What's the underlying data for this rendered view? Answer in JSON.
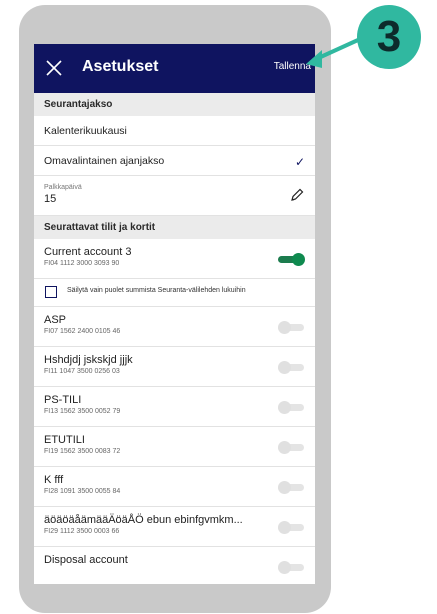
{
  "header": {
    "title": "Asetukset",
    "save_label": "Tallenna"
  },
  "tracking_period": {
    "section_title": "Seurantajakso",
    "options": [
      {
        "label": "Kalenterikuukausi",
        "selected": false
      },
      {
        "label": "Omavalintainen ajanjakso",
        "selected": true
      }
    ],
    "payday_label": "Palkkapäivä",
    "payday_value": "15"
  },
  "accounts_section": {
    "section_title": "Seurattavat tilit ja kortit",
    "half_sum_checkbox_label": "Säilytä vain puolet summista Seuranta-välilehden lukuihin",
    "half_sum_checked": false,
    "accounts": [
      {
        "name": "Current account 3",
        "iban": "FI04 1112 3000 3093 90",
        "enabled": true
      },
      {
        "name": "ASP",
        "iban": "FI07 1562 2400 0105 46",
        "enabled": false
      },
      {
        "name": "Hshdjdj jskskjd jjjk",
        "iban": "FI11 1047 3500 0256 03",
        "enabled": false
      },
      {
        "name": "PS-TILI",
        "iban": "FI13 1562 3500 0052 79",
        "enabled": false
      },
      {
        "name": "ETUTILI",
        "iban": "FI19 1562 3500 0083 72",
        "enabled": false
      },
      {
        "name": "K fff",
        "iban": "FI28 1091 3500 0055 84",
        "enabled": false
      },
      {
        "name": "äöäöäåämääÄöäÅÖ ebun ebinfgvmkm...",
        "iban": "FI29 1112 3500 0003 66",
        "enabled": false
      },
      {
        "name": "Disposal account",
        "iban": "",
        "enabled": false
      }
    ]
  },
  "callout": {
    "step_number": "3"
  },
  "colors": {
    "header_bg": "#0f1460",
    "toggle_on": "#0f8a4f",
    "callout_bg": "#30b8a0"
  }
}
